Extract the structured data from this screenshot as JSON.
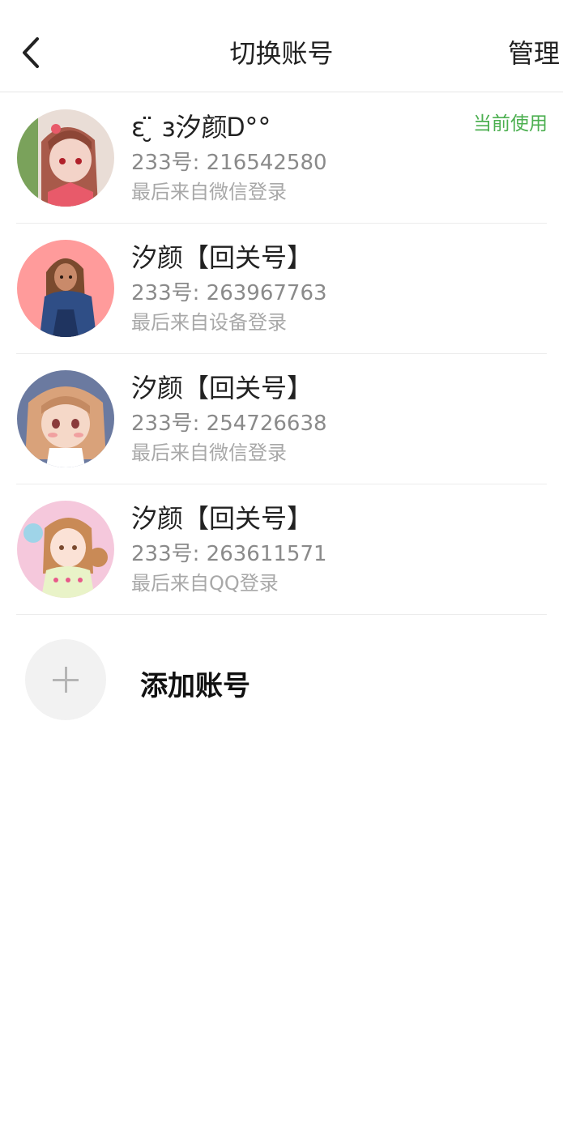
{
  "header": {
    "title": "切换账号",
    "manage_label": "管理"
  },
  "accounts": [
    {
      "name": "ε ̮̈ ɜ汐颜Ꭰ°°",
      "id_text": "233号: 216542580",
      "login_text": "最后来自微信登录",
      "status": "当前使用",
      "avatar_colors": [
        "#7aa25b",
        "#a85a4a",
        "#f3d3c8"
      ]
    },
    {
      "name": "汐颜【回关号】",
      "id_text": "233号: 263967763",
      "login_text": "最后来自设备登录",
      "avatar_colors": [
        "#ff9b9b",
        "#2f4e86",
        "#7a4a2e"
      ]
    },
    {
      "name": "汐颜【回关号】",
      "id_text": "233号: 254726638",
      "login_text": "最后来自微信登录",
      "avatar_colors": [
        "#6b7aa0",
        "#d9a27a",
        "#f5d8c8"
      ]
    },
    {
      "name": "汐颜【回关号】",
      "id_text": "233号: 263611571",
      "login_text": "最后来自QQ登录",
      "avatar_colors": [
        "#f5c8dc",
        "#c98a56",
        "#9fd4e8"
      ]
    }
  ],
  "add_account": {
    "label": "添加账号"
  }
}
